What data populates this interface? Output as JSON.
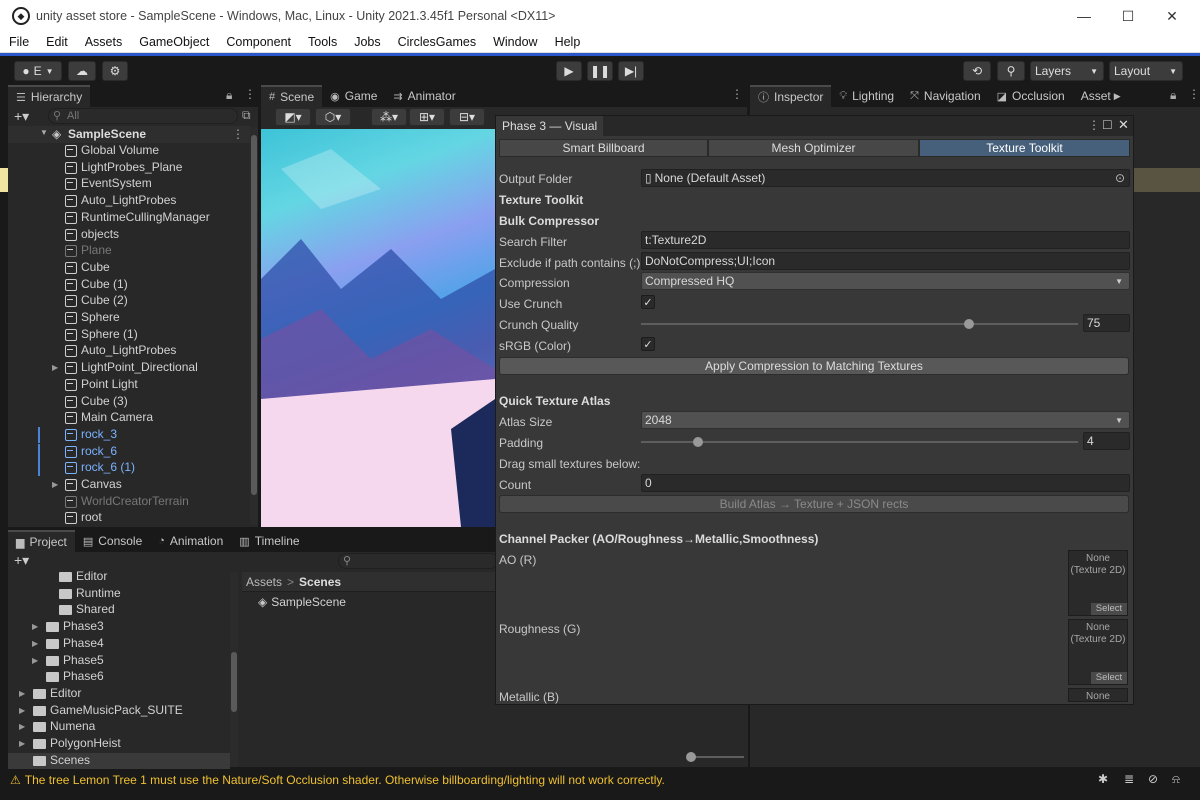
{
  "window": {
    "title": "unity asset store - SampleScene - Windows, Mac, Linux - Unity 2021.3.45f1 Personal <DX11>",
    "logo": "unity-logo",
    "minimize": "—",
    "maximize": "☐",
    "close": "✕"
  },
  "menu": [
    "File",
    "Edit",
    "Assets",
    "GameObject",
    "Component",
    "Tools",
    "Jobs",
    "CirclesGames",
    "Window",
    "Help"
  ],
  "toolbar": {
    "account": "E",
    "layers": "Layers",
    "layout": "Layout"
  },
  "hierarchy": {
    "tab": "Hierarchy",
    "search_placeholder": "All",
    "scene": "SampleScene",
    "items": [
      {
        "label": "Global Volume",
        "style": "normal"
      },
      {
        "label": "LightProbes_Plane",
        "style": "normal"
      },
      {
        "label": "EventSystem",
        "style": "normal"
      },
      {
        "label": "Auto_LightProbes",
        "style": "normal"
      },
      {
        "label": "RuntimeCullingManager",
        "style": "normal"
      },
      {
        "label": "objects",
        "style": "normal"
      },
      {
        "label": "Plane",
        "style": "dim"
      },
      {
        "label": "Cube",
        "style": "normal"
      },
      {
        "label": "Cube (1)",
        "style": "normal"
      },
      {
        "label": "Cube (2)",
        "style": "normal"
      },
      {
        "label": "Sphere",
        "style": "normal"
      },
      {
        "label": "Sphere (1)",
        "style": "normal"
      },
      {
        "label": "Auto_LightProbes",
        "style": "normal"
      },
      {
        "label": "LightPoint_Directional",
        "style": "normal"
      },
      {
        "label": "Point Light",
        "style": "normal"
      },
      {
        "label": "Cube (3)",
        "style": "normal"
      },
      {
        "label": "Main Camera",
        "style": "normal"
      },
      {
        "label": "rock_3",
        "style": "blue"
      },
      {
        "label": "rock_6",
        "style": "blue"
      },
      {
        "label": "rock_6 (1)",
        "style": "blue"
      },
      {
        "label": "Canvas",
        "style": "normal"
      },
      {
        "label": "WorldCreatorTerrain",
        "style": "dim"
      },
      {
        "label": "root",
        "style": "normal"
      }
    ]
  },
  "scene_tabs": [
    "Scene",
    "Game",
    "Animator"
  ],
  "inspector_tabs": [
    "Inspector",
    "Lighting",
    "Navigation",
    "Occlusion",
    "Asset"
  ],
  "bottom_tabs": [
    "Project",
    "Console",
    "Animation",
    "Timeline"
  ],
  "project": {
    "tree": [
      {
        "label": "Editor",
        "indent": 3,
        "arrow": false
      },
      {
        "label": "Runtime",
        "indent": 3,
        "arrow": false
      },
      {
        "label": "Shared",
        "indent": 3,
        "arrow": false
      },
      {
        "label": "Phase3",
        "indent": 2,
        "arrow": true
      },
      {
        "label": "Phase4",
        "indent": 2,
        "arrow": true
      },
      {
        "label": "Phase5",
        "indent": 2,
        "arrow": true
      },
      {
        "label": "Phase6",
        "indent": 2,
        "arrow": false
      },
      {
        "label": "Editor",
        "indent": 1,
        "arrow": true
      },
      {
        "label": "GameMusicPack_SUITE",
        "indent": 1,
        "arrow": true
      },
      {
        "label": "Numena",
        "indent": 1,
        "arrow": true
      },
      {
        "label": "PolygonHeist",
        "indent": 1,
        "arrow": true
      },
      {
        "label": "Scenes",
        "indent": 1,
        "arrow": false
      }
    ],
    "breadcrumb_root": "Assets",
    "breadcrumb_sep": ">",
    "breadcrumb_current": "Scenes",
    "file": "SampleScene"
  },
  "phase_window": {
    "title": "Phase 3 — Visual",
    "tabs": [
      "Smart Billboard",
      "Mesh Optimizer",
      "Texture Toolkit"
    ],
    "output_folder_label": "Output Folder",
    "output_folder_value": "None (Default Asset)",
    "section_title": "Texture Toolkit",
    "bulk_title": "Bulk Compressor",
    "search_filter_label": "Search Filter",
    "search_filter_value": "t:Texture2D",
    "exclude_label": "Exclude if path contains (;)",
    "exclude_value": "DoNotCompress;UI;Icon",
    "compression_label": "Compression",
    "compression_value": "Compressed HQ",
    "use_crunch_label": "Use Crunch",
    "use_crunch": true,
    "crunch_quality_label": "Crunch Quality",
    "crunch_quality_value": "75",
    "crunch_quality_fraction": 0.75,
    "srgb_label": "sRGB (Color)",
    "srgb": true,
    "apply_button": "Apply Compression to Matching Textures",
    "atlas_title": "Quick Texture Atlas",
    "atlas_size_label": "Atlas Size",
    "atlas_size_value": "2048",
    "padding_label": "Padding",
    "padding_value": "4",
    "padding_fraction": 0.13,
    "drag_label": "Drag small textures below:",
    "count_label": "Count",
    "count_value": "0",
    "build_button": "Build Atlas → Texture + JSON rects",
    "channel_title": "Channel Packer (AO/Roughness→Metallic,Smoothness)",
    "ao_label": "AO (R)",
    "roughness_label": "Roughness (G)",
    "metallic_label": "Metallic (B)",
    "slot_none": "None",
    "slot_type": "(Texture 2D)",
    "slot_select": "Select"
  },
  "status": {
    "message": "The tree Lemon Tree 1 must use the Nature/Soft Occlusion shader. Otherwise billboarding/lighting will not work correctly."
  },
  "colors": {
    "accent": "#2a57c9",
    "selected_tab": "#46607c",
    "warning": "#f0c030",
    "prefab_blue": "#7bb3ff"
  }
}
